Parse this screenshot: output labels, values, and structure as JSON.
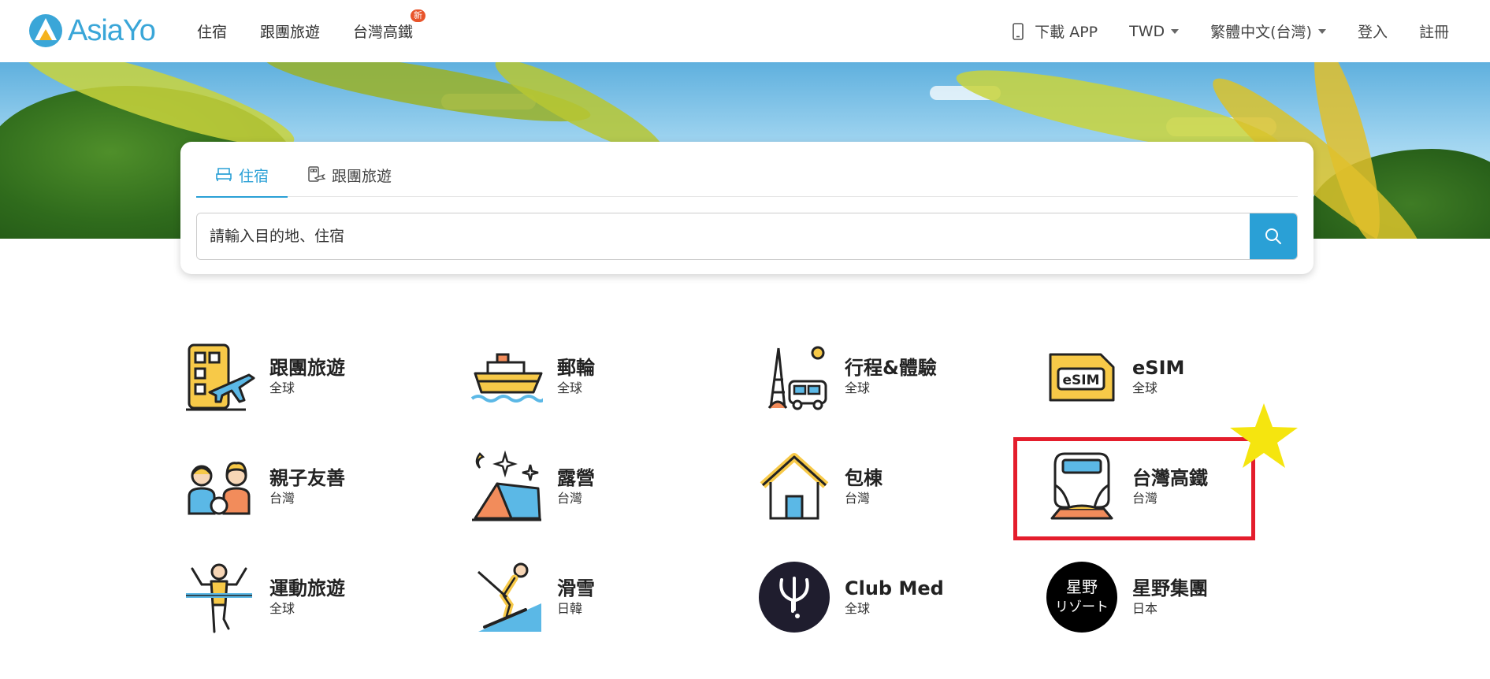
{
  "header": {
    "logo_text": "AsiaYo",
    "nav": [
      {
        "label": "住宿"
      },
      {
        "label": "跟團旅遊"
      },
      {
        "label": "台灣高鐵",
        "badge": "新"
      }
    ],
    "download_app": "下載 APP",
    "currency": "TWD",
    "language": "繁體中文(台灣)",
    "login": "登入",
    "register": "註冊"
  },
  "search": {
    "tabs": [
      {
        "label": "住宿",
        "active": true,
        "icon": "bed-icon"
      },
      {
        "label": "跟團旅遊",
        "active": false,
        "icon": "tour-icon"
      }
    ],
    "placeholder": "請輸入目的地、住宿"
  },
  "categories": [
    {
      "name": "跟團旅遊",
      "region": "全球",
      "icon": "building-plane-icon"
    },
    {
      "name": "郵輪",
      "region": "全球",
      "icon": "cruise-ship-icon"
    },
    {
      "name": "行程&體驗",
      "region": "全球",
      "icon": "eiffel-bus-icon"
    },
    {
      "name": "eSIM",
      "region": "全球",
      "icon": "esim-card-icon",
      "icon_text": "eSIM"
    },
    {
      "name": "親子友善",
      "region": "台灣",
      "icon": "family-icon"
    },
    {
      "name": "露營",
      "region": "台灣",
      "icon": "tent-icon"
    },
    {
      "name": "包棟",
      "region": "台灣",
      "icon": "house-icon"
    },
    {
      "name": "台灣高鐵",
      "region": "台灣",
      "icon": "train-icon"
    },
    {
      "name": "運動旅遊",
      "region": "全球",
      "icon": "runner-icon"
    },
    {
      "name": "滑雪",
      "region": "日韓",
      "icon": "skier-icon"
    },
    {
      "name": "Club Med",
      "region": "全球",
      "icon": "clubmed-logo-icon"
    },
    {
      "name": "星野集團",
      "region": "日本",
      "icon": "hoshino-logo-icon",
      "icon_text": [
        "星野",
        "リゾート"
      ]
    }
  ],
  "colors": {
    "brand": "#2aa0d6",
    "highlight": "#e41d2c",
    "star": "#f5e50f",
    "badge": "#e8542b"
  }
}
